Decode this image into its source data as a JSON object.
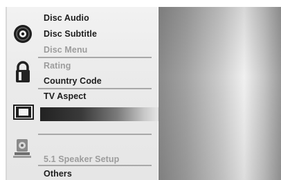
{
  "menu": {
    "items": [
      {
        "label": "Disc Audio"
      },
      {
        "label": "Disc Subtitle"
      },
      {
        "label": "Disc Menu"
      },
      {
        "label": "Rating"
      },
      {
        "label": "Country Code"
      },
      {
        "label": "TV Aspect"
      },
      {
        "label": "5.1 Speaker Setup"
      },
      {
        "label": "Others"
      }
    ]
  },
  "icons": {
    "disc": "disc-icon",
    "lock": "padlock-icon",
    "tv": "tv-aspect-icon",
    "speaker": "speaker-icon"
  },
  "colors": {
    "active_text": "#1c1c1c",
    "inactive_text": "#9c9c9c",
    "menu_bg": "#ececec"
  }
}
